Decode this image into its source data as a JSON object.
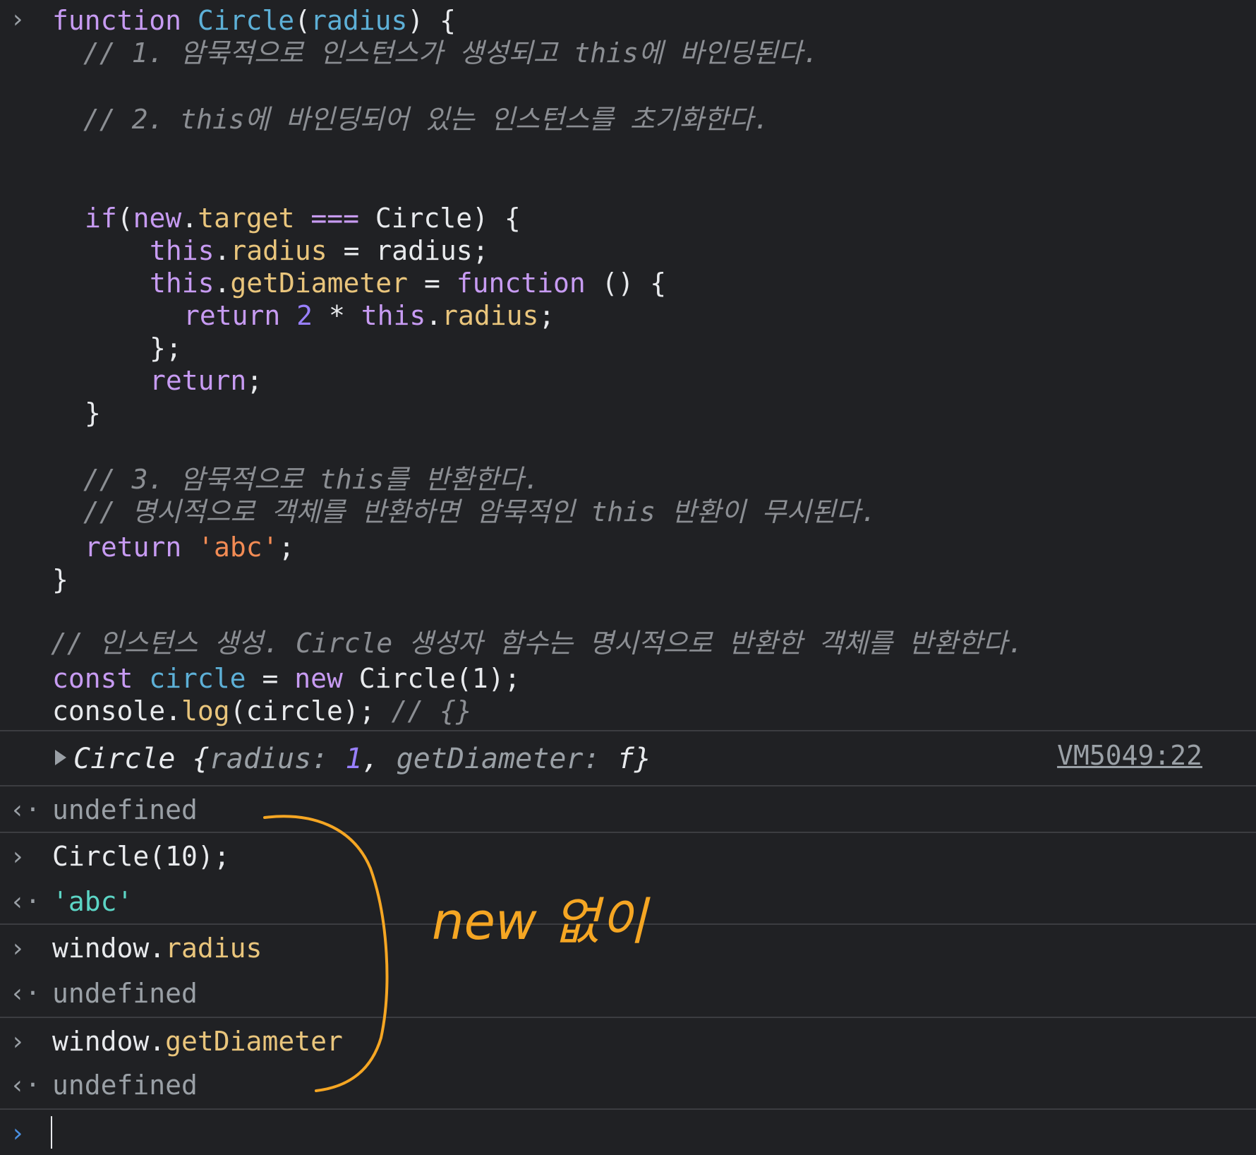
{
  "code": {
    "line1": {
      "kw": "function",
      "name": "Circle",
      "open": "(",
      "param": "radius",
      "close": ") {"
    },
    "comment1": "// 1. 암묵적으로 인스턴스가 생성되고 this에 바인딩된다.",
    "comment2": "// 2. this에 바인딩되어 있는 인스턴스를 초기화한다.",
    "if_line": {
      "kw": "if",
      "open": "(",
      "new": "new",
      "dot": ".",
      "target": "target",
      "eq": " === ",
      "name": "Circle",
      "close": ") {"
    },
    "assign_radius": {
      "this": "this",
      "dot": ".",
      "prop": "radius",
      "rest": " = radius;"
    },
    "assign_diam": {
      "this": "this",
      "dot": ".",
      "prop": "getDiameter",
      "eq": " = ",
      "kw": "function",
      "rest": " () {"
    },
    "return_line": {
      "kw": "return",
      "num": "2",
      "op": " * ",
      "this": "this",
      "dot": ".",
      "prop": "radius",
      "semi": ";"
    },
    "close_fn": "};",
    "return_empty": {
      "kw": "return",
      "semi": ";"
    },
    "close_if": "}",
    "comment3": "// 3. 암묵적으로 this를 반환한다.",
    "comment4": "// 명시적으로 객체를 반환하면 암묵적인 this 반환이 무시된다.",
    "return_abc": {
      "kw": "return",
      "str": "'abc'",
      "semi": ";"
    },
    "close_main": "}",
    "comment5": "// 인스턴스 생성. Circle 생성자 함수는 명시적으로 반환한 객체를 반환한다.",
    "const_line": {
      "kw": "const",
      "var": "circle",
      "eq": " = ",
      "new": "new",
      "call": " Circle(",
      "num": "1",
      "close": ");"
    },
    "log_line": {
      "obj": "console",
      "dot": ".",
      "fn": "log",
      "args": "(circle);",
      "comment": " // {}"
    }
  },
  "output": {
    "object_name": "Circle",
    "object_open": " {",
    "key1": "radius",
    "colon1": ": ",
    "val1": "1",
    "sep": ", ",
    "key2": "getDiameter",
    "colon2": ": ",
    "val2": "f",
    "object_close": "}",
    "source_link": "VM5049:22"
  },
  "history": [
    {
      "type": "result",
      "text": "undefined"
    },
    {
      "type": "input",
      "name": "Circle",
      "open": "(",
      "num": "10",
      "close": ");"
    },
    {
      "type": "result",
      "text": "'abc'"
    },
    {
      "type": "input",
      "obj": "window",
      "dot": ".",
      "prop": "radius"
    },
    {
      "type": "result",
      "text": "undefined"
    },
    {
      "type": "input",
      "obj": "window",
      "dot": ".",
      "prop": "getDiameter"
    },
    {
      "type": "result",
      "text": "undefined"
    }
  ],
  "annotation": {
    "text": "new 없이",
    "color": "#f5a623"
  },
  "icons": {
    "input": "chevron-right-icon",
    "result": "return-arrow-icon"
  }
}
